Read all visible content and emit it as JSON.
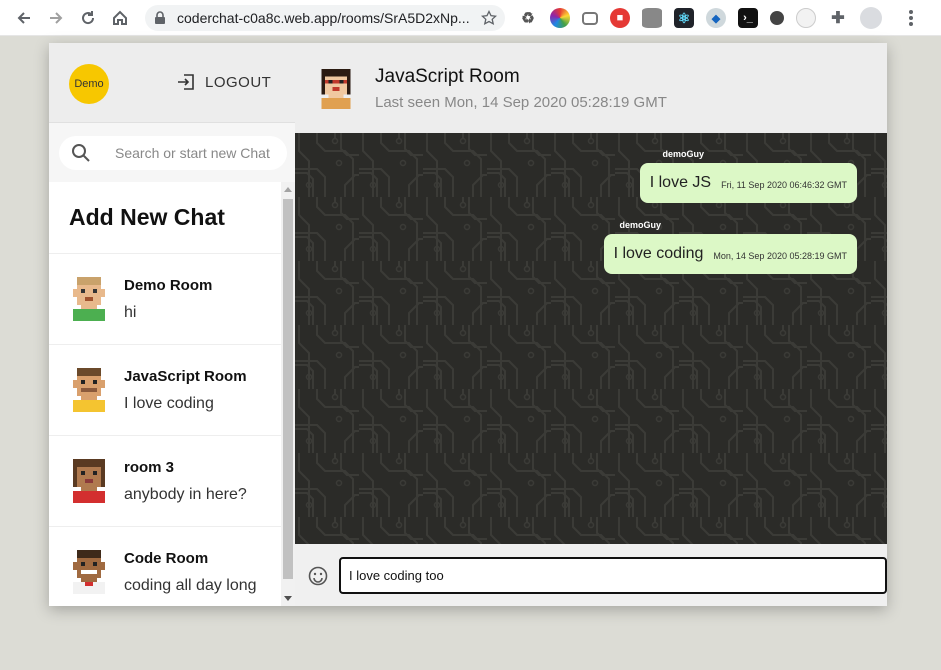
{
  "browser": {
    "url": "coderchat-c0a8c.web.app/rooms/SrA5D2xNp..."
  },
  "sidebar": {
    "avatar_label": "Demo",
    "logout_label": "LOGOUT",
    "search_placeholder": "Search or start new Chat",
    "add_chat_label": "Add New Chat",
    "chats": [
      {
        "name": "Demo Room",
        "last_message": "hi",
        "avatar": "pixel-avatar-green-shirt"
      },
      {
        "name": "JavaScript Room",
        "last_message": "I love coding",
        "avatar": "pixel-avatar-yellow-shirt"
      },
      {
        "name": "room 3",
        "last_message": "anybody in here?",
        "avatar": "pixel-avatar-red-shirt"
      },
      {
        "name": "Code Room",
        "last_message": "coding all day long",
        "avatar": "pixel-avatar-red-bowtie"
      }
    ]
  },
  "chat": {
    "title": "JavaScript Room",
    "subtitle": "Last seen Mon, 14 Sep 2020 05:28:19 GMT",
    "messages": [
      {
        "sender": "demoGuy",
        "text": "I love JS",
        "time": "Fri, 11 Sep 2020 06:46:32 GMT"
      },
      {
        "sender": "demoGuy",
        "text": "I love coding",
        "time": "Mon, 14 Sep 2020 05:28:19 GMT"
      }
    ],
    "input_value": "I love coding too"
  },
  "colors": {
    "bubble": "#dcf8c6",
    "avatar_yellow": "#f7c700",
    "chat_background": "#2b2b28"
  }
}
